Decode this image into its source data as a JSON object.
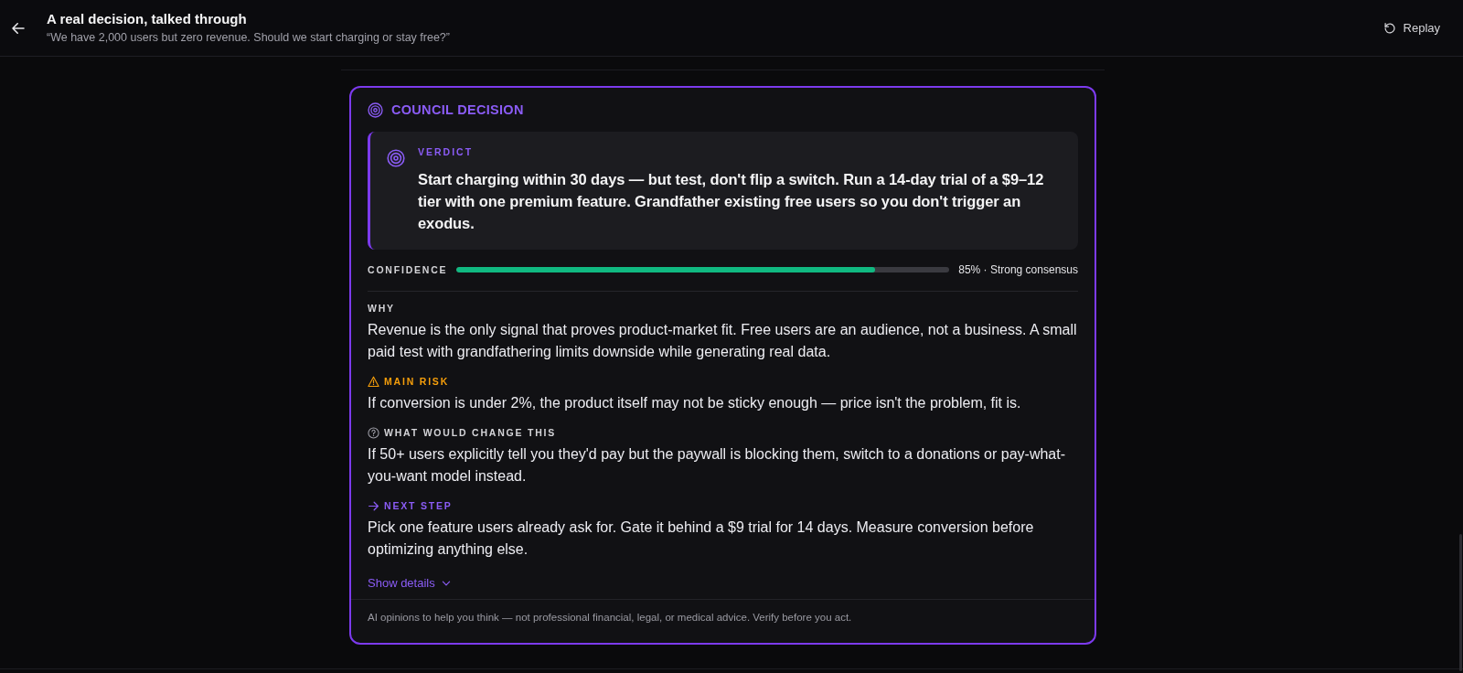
{
  "header": {
    "title": "A real decision, talked through",
    "subtitle": "“We have 2,000 users but zero revenue. Should we start charging or stay free?”",
    "replay": "Replay"
  },
  "decision": {
    "title": "COUNCIL DECISION",
    "verdict": {
      "label": "VERDICT",
      "text": "Start charging within 30 days — but test, don't flip a switch. Run a 14-day trial of a $9–12 tier with one premium feature. Grandfather existing free users so you don't trigger an exodus."
    },
    "confidence": {
      "label": "CONFIDENCE",
      "level": 0.85,
      "reading": "85% · Strong consensus"
    },
    "sections": [
      {
        "kind": "plain",
        "label": "WHY",
        "text": "Revenue is the only signal that proves product-market fit. Free users are an audience, not a business. A small paid test with grandfathering limits downside while generating real data."
      },
      {
        "kind": "warning",
        "label": "MAIN RISK",
        "text": "If conversion is under 2%, the product itself may not be sticky enough — price isn't the problem, fit is."
      },
      {
        "kind": "question",
        "label": "WHAT WOULD CHANGE THIS",
        "text": "If 50+ users explicitly tell you they'd pay but the paywall is blocking them, switch to a donations or pay-what-you-want model instead."
      },
      {
        "kind": "next",
        "label": "NEXT STEP",
        "text": "Pick one feature users already ask for. Gate it behind a $9 trial for 14 days. Measure conversion before optimizing anything else."
      }
    ],
    "details": {
      "label": "Show details",
      "expanded": false
    },
    "disclaimer": "AI opinions to help you think — not professional financial, legal, or medical advice. Verify before you act."
  }
}
